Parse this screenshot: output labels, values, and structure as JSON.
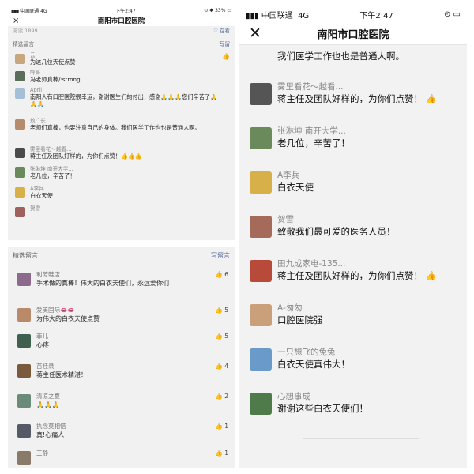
{
  "left_top": {
    "status": {
      "carrier": "中国联通",
      "network": "4G",
      "time": "下午2:47",
      "battery": "33%"
    },
    "title": "南阳市口腔医院",
    "close_icon": "×",
    "read_label": "阅读 1899",
    "read_right": "♡ 在看",
    "section": {
      "title": "精选留言",
      "write": "写留"
    },
    "comments": [
      {
        "name": "云",
        "text": "为这几位天使点赞",
        "avatar": "#c7a77f"
      },
      {
        "name": "吟哥",
        "text": "冯老师真棒/:strong",
        "avatar": "#5a6e5a"
      },
      {
        "name": "April",
        "text": "南阳人有口腔医院很幸运，谢谢医生们的付出，感谢🙏🙏🙏您们辛苦了🙏🙏🙏",
        "avatar": "#a5c0d6"
      },
      {
        "name": "敖广长",
        "text": "老师们真棒，也要注意自己的身体。我们医学工作也也是普通人啊。",
        "avatar": "#b58b6b"
      },
      {
        "name": "雾里看花～越看...",
        "text": "蒋主任及团队好样的，为你们点赞！👍👍👍",
        "avatar": "#4a4a4a"
      },
      {
        "name": "张琳坤 南开大学...",
        "text": "老几位，辛苦了！",
        "avatar": "#6b8a5b"
      },
      {
        "name": "A李兵",
        "text": "白衣天使",
        "avatar": "#d8b04a"
      },
      {
        "name": "贺雪",
        "text": "",
        "avatar": "#a06060"
      }
    ]
  },
  "left_bottom": {
    "section": {
      "title": "精选留言",
      "write": "写留言"
    },
    "comments": [
      {
        "name": "利芳鞋店",
        "text": "手术做的真棒！伟大的白衣天使们，永远爱你们",
        "likes": "6",
        "avatar": "#8c6a8c"
      },
      {
        "name": "爱美国际👄👄",
        "text": "为伟大的白衣天使点赞",
        "likes": "5",
        "avatar": "#b98a6a"
      },
      {
        "name": "菲儿",
        "text": "心疼",
        "likes": "5",
        "avatar": "#3f5f4f"
      },
      {
        "name": "苗桂录",
        "text": "蒋主任医术精湛！",
        "likes": "4",
        "avatar": "#7a5a3a"
      },
      {
        "name": "清凉之夏",
        "text": "🙏🙏🙏",
        "likes": "2",
        "avatar": "#6a8a7a"
      },
      {
        "name": "执念莫相惜",
        "text": "真!心痛人",
        "likes": "1",
        "avatar": "#555a66"
      },
      {
        "name": "王静",
        "text": "",
        "likes": "1",
        "avatar": "#8a7a6a"
      }
    ]
  },
  "right": {
    "status": {
      "carrier": "中国联通",
      "network": "4G",
      "time": "下午2:47"
    },
    "title": "南阳市口腔医院",
    "close_icon": "✕",
    "top_text": "我们医学工作也也是普通人啊。",
    "comments": [
      {
        "name": "雾里看花～越看...",
        "text": "蒋主任及团队好样的，为你们点赞！",
        "thumb": "👍",
        "avatar": "#555"
      },
      {
        "name": "张淋坤 南开大学...",
        "text": "老几位，辛苦了！",
        "avatar": "#6b8a5b"
      },
      {
        "name": "A李兵",
        "text": "白衣天使",
        "avatar": "#d8b04a"
      },
      {
        "name": "贺雪",
        "text": "致敬我们最可爱的医务人员！",
        "avatar": "#a56a5a"
      },
      {
        "name": "田九成家电-135...",
        "text": "蒋主任及团队好样的，为你们点赞！",
        "thumb": "👍",
        "avatar": "#b84a3a"
      },
      {
        "name": "A-匆匆",
        "text": "口腔医院强",
        "avatar": "#c9a07a"
      },
      {
        "name": "一只想飞的兔兔",
        "text": "白衣天使真伟大！",
        "avatar": "#6a9ac9"
      },
      {
        "name": "心想事成",
        "text": "谢谢这些白衣天使们！",
        "avatar": "#4f7a4a"
      }
    ]
  }
}
